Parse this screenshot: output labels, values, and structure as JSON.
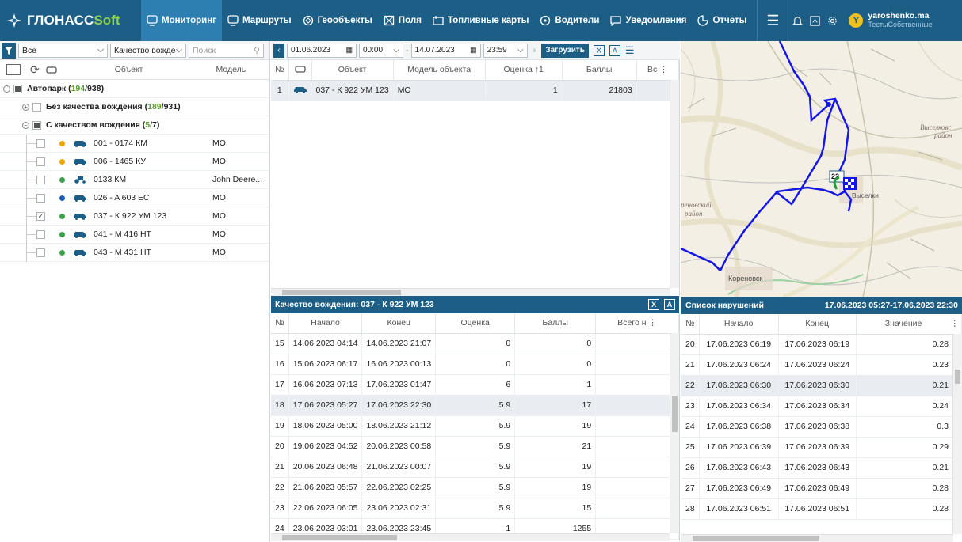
{
  "app": {
    "logo_main": "ГЛОНАСС",
    "logo_soft": "Soft",
    "nav": [
      {
        "label": "Мониторинг",
        "icon": "monitor-icon",
        "active": true
      },
      {
        "label": "Маршруты",
        "icon": "route-icon"
      },
      {
        "label": "Геообъекты",
        "icon": "geo-icon"
      },
      {
        "label": "Поля",
        "icon": "field-icon"
      },
      {
        "label": "Топливные карты",
        "icon": "fuel-card-icon"
      },
      {
        "label": "Водители",
        "icon": "driver-icon"
      },
      {
        "label": "Уведомления",
        "icon": "notification-icon"
      },
      {
        "label": "Отчеты",
        "icon": "report-icon"
      }
    ],
    "user": {
      "initial": "Y",
      "name": "yaroshenko.ma",
      "account": "ТестыСобственные"
    }
  },
  "left": {
    "filter_all": "Все",
    "filter_quality": "Качество вожде",
    "search_placeholder": "Поиск",
    "col_object": "Объект",
    "col_model": "Модель",
    "root": {
      "label": "Автопарк",
      "count_a": "194",
      "count_b": "938"
    },
    "group1": {
      "label": "Без качества вождения",
      "count_a": "189",
      "count_b": "931"
    },
    "group2": {
      "label": "С качеством вождения",
      "count_a": "5",
      "count_b": "7"
    },
    "vehicles": [
      {
        "name": "001 - 0174 КМ",
        "model": "MO",
        "dot": "#f0a500",
        "checked": false
      },
      {
        "name": "006 - 1465 КУ",
        "model": "MO",
        "dot": "#f0a500",
        "checked": false
      },
      {
        "name": "0133 КМ",
        "model": "John Deere...",
        "dot": "#3aa34a",
        "checked": false,
        "tractor": true
      },
      {
        "name": "026 - A 603 EC",
        "model": "MO",
        "dot": "#1c5eb6",
        "checked": false
      },
      {
        "name": "037 - К 922 УМ 123",
        "model": "MO",
        "dot": "#3aa34a",
        "checked": true
      },
      {
        "name": "041 - М 416 НТ",
        "model": "MO",
        "dot": "#3aa34a",
        "checked": false
      },
      {
        "name": "043 - М 431 НТ",
        "model": "MO",
        "dot": "#3aa34a",
        "checked": false
      }
    ]
  },
  "toolbar": {
    "date_from": "01.06.2023",
    "time_from": "00:00",
    "date_to": "14.07.2023",
    "time_to": "23:59",
    "load_label": "Загрузить"
  },
  "objects_table": {
    "headers": [
      "№",
      "",
      "Объект",
      "Модель объекта",
      "Оценка ↑1",
      "Баллы",
      "Вс"
    ],
    "rows": [
      {
        "n": "1",
        "object": "037 - К 922 УМ 123",
        "model": "MO",
        "score": "1",
        "points": "21803"
      }
    ]
  },
  "quality": {
    "title": "Качество вождения: 037 - К 922 УМ 123",
    "headers": [
      "№",
      "Начало",
      "Конец",
      "Оценка",
      "Баллы",
      "Всего н"
    ],
    "rows": [
      {
        "n": "15",
        "start": "14.06.2023 04:14",
        "end": "14.06.2023 21:07",
        "score": "0",
        "points": "0"
      },
      {
        "n": "16",
        "start": "15.06.2023 06:17",
        "end": "16.06.2023 00:13",
        "score": "0",
        "points": "0"
      },
      {
        "n": "17",
        "start": "16.06.2023 07:13",
        "end": "17.06.2023 01:47",
        "score": "6",
        "points": "1"
      },
      {
        "n": "18",
        "start": "17.06.2023 05:27",
        "end": "17.06.2023 22:30",
        "score": "5.9",
        "points": "17",
        "selected": true
      },
      {
        "n": "19",
        "start": "18.06.2023 05:00",
        "end": "18.06.2023 21:12",
        "score": "5.9",
        "points": "19"
      },
      {
        "n": "20",
        "start": "19.06.2023 04:52",
        "end": "20.06.2023 00:58",
        "score": "5.9",
        "points": "21"
      },
      {
        "n": "21",
        "start": "20.06.2023 06:48",
        "end": "21.06.2023 00:07",
        "score": "5.9",
        "points": "19"
      },
      {
        "n": "22",
        "start": "21.06.2023 05:57",
        "end": "22.06.2023 02:25",
        "score": "5.9",
        "points": "19"
      },
      {
        "n": "23",
        "start": "22.06.2023 06:05",
        "end": "23.06.2023 02:31",
        "score": "5.9",
        "points": "15"
      },
      {
        "n": "24",
        "start": "23.06.2023 03:01",
        "end": "23.06.2023 23:45",
        "score": "1",
        "points": "1255"
      }
    ]
  },
  "violations": {
    "title": "Список нарушений",
    "range": "17.06.2023 05:27-17.06.2023 22:30",
    "headers": [
      "№",
      "Начало",
      "Конец",
      "Значение"
    ],
    "rows": [
      {
        "n": "20",
        "start": "17.06.2023 06:19",
        "end": "17.06.2023 06:19",
        "value": "0.28"
      },
      {
        "n": "21",
        "start": "17.06.2023 06:24",
        "end": "17.06.2023 06:24",
        "value": "0.23"
      },
      {
        "n": "22",
        "start": "17.06.2023 06:30",
        "end": "17.06.2023 06:30",
        "value": "0.21",
        "selected": true
      },
      {
        "n": "23",
        "start": "17.06.2023 06:34",
        "end": "17.06.2023 06:34",
        "value": "0.24"
      },
      {
        "n": "24",
        "start": "17.06.2023 06:38",
        "end": "17.06.2023 06:38",
        "value": "0.3"
      },
      {
        "n": "25",
        "start": "17.06.2023 06:39",
        "end": "17.06.2023 06:39",
        "value": "0.29"
      },
      {
        "n": "26",
        "start": "17.06.2023 06:43",
        "end": "17.06.2023 06:43",
        "value": "0.21"
      },
      {
        "n": "27",
        "start": "17.06.2023 06:49",
        "end": "17.06.2023 06:49",
        "value": "0.28"
      },
      {
        "n": "28",
        "start": "17.06.2023 06:51",
        "end": "17.06.2023 06:51",
        "value": "0.28"
      }
    ]
  },
  "map": {
    "labels": {
      "town1": "Выселковс",
      "town1b": "район",
      "town2": "Кореновск",
      "town3": "реновский",
      "town3b": "район",
      "marker_num": "22",
      "town4": "Выселки"
    }
  }
}
